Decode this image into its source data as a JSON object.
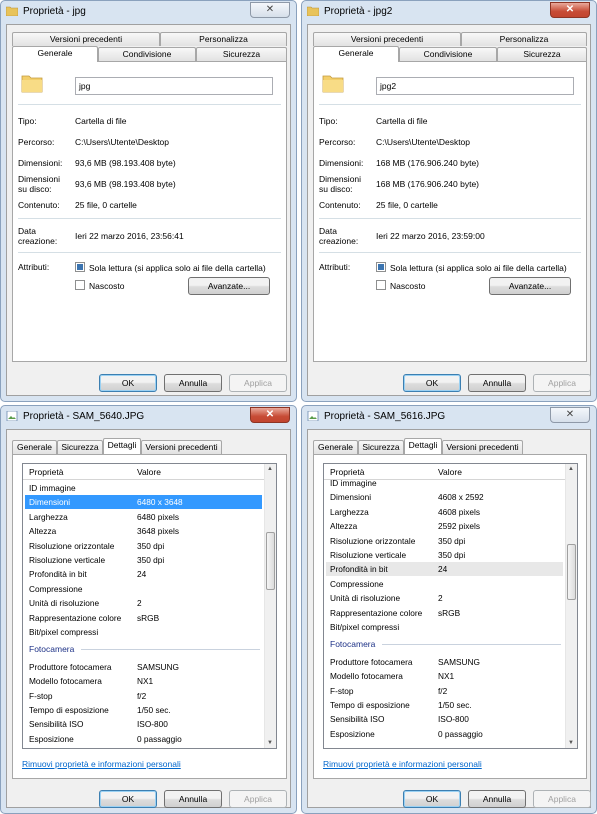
{
  "w1": {
    "title": "Proprietà - jpg",
    "tabs_top": [
      "Versioni precedenti",
      "Personalizza"
    ],
    "tabs_bottom": [
      "Generale",
      "Condivisione",
      "Sicurezza"
    ],
    "name_value": "jpg",
    "rows": [
      {
        "label": "Tipo:",
        "value": "Cartella di file"
      },
      {
        "label": "Percorso:",
        "value": "C:\\Users\\Utente\\Desktop"
      },
      {
        "label": "Dimensioni:",
        "value": "93,6 MB (98.193.408 byte)"
      },
      {
        "label": "Dimensioni su disco:",
        "value": "93,6 MB (98.193.408 byte)"
      },
      {
        "label": "Contenuto:",
        "value": "25 file, 0 cartelle"
      },
      {
        "label": "Data creazione:",
        "value": "Ieri 22 marzo 2016, 23:56:41"
      }
    ],
    "attr_label": "Attributi:",
    "readonly_label": "Sola lettura (si applica solo ai file della cartella)",
    "hidden_label": "Nascosto",
    "advanced_label": "Avanzate...",
    "ok": "OK",
    "cancel": "Annulla",
    "apply": "Applica"
  },
  "w2": {
    "title": "Proprietà - jpg2",
    "tabs_top": [
      "Versioni precedenti",
      "Personalizza"
    ],
    "tabs_bottom": [
      "Generale",
      "Condivisione",
      "Sicurezza"
    ],
    "name_value": "jpg2",
    "rows": [
      {
        "label": "Tipo:",
        "value": "Cartella di file"
      },
      {
        "label": "Percorso:",
        "value": "C:\\Users\\Utente\\Desktop"
      },
      {
        "label": "Dimensioni:",
        "value": "168 MB (176.906.240 byte)"
      },
      {
        "label": "Dimensioni su disco:",
        "value": "168 MB (176.906.240 byte)"
      },
      {
        "label": "Contenuto:",
        "value": "25 file, 0 cartelle"
      },
      {
        "label": "Data creazione:",
        "value": "Ieri 22 marzo 2016, 23:59:00"
      }
    ],
    "attr_label": "Attributi:",
    "readonly_label": "Sola lettura (si applica solo ai file della cartella)",
    "hidden_label": "Nascosto",
    "advanced_label": "Avanzate...",
    "ok": "OK",
    "cancel": "Annulla",
    "apply": "Applica"
  },
  "w3": {
    "title": "Proprietà - SAM_5640.JPG",
    "tabs": [
      "Generale",
      "Sicurezza",
      "Dettagli",
      "Versioni precedenti"
    ],
    "col_prop": "Proprietà",
    "col_val": "Valore",
    "rows": [
      {
        "k": "ID immagine",
        "v": ""
      },
      {
        "k": "Dimensioni",
        "v": "6480 x 3648"
      },
      {
        "k": "Larghezza",
        "v": "6480 pixels"
      },
      {
        "k": "Altezza",
        "v": "3648 pixels"
      },
      {
        "k": "Risoluzione orizzontale",
        "v": "350 dpi"
      },
      {
        "k": "Risoluzione verticale",
        "v": "350 dpi"
      },
      {
        "k": "Profondità in bit",
        "v": "24"
      },
      {
        "k": "Compressione",
        "v": ""
      },
      {
        "k": "Unità di risoluzione",
        "v": "2"
      },
      {
        "k": "Rappresentazione colore",
        "v": "sRGB"
      },
      {
        "k": "Bit/pixel compressi",
        "v": ""
      }
    ],
    "group": "Fotocamera",
    "rows2": [
      {
        "k": "Produttore fotocamera",
        "v": "SAMSUNG"
      },
      {
        "k": "Modello fotocamera",
        "v": "NX1"
      },
      {
        "k": "F-stop",
        "v": "f/2"
      },
      {
        "k": "Tempo di esposizione",
        "v": "1/50 sec."
      },
      {
        "k": "Sensibilità ISO",
        "v": "ISO-800"
      },
      {
        "k": "Esposizione",
        "v": "0 passaggio"
      }
    ],
    "link": "Rimuovi proprietà e informazioni personali",
    "ok": "OK",
    "cancel": "Annulla",
    "apply": "Applica"
  },
  "w4": {
    "title": "Proprietà - SAM_5616.JPG",
    "tabs": [
      "Generale",
      "Sicurezza",
      "Dettagli",
      "Versioni precedenti"
    ],
    "col_prop": "Proprietà",
    "col_val": "Valore",
    "rows": [
      {
        "k": "ID immagine",
        "v": ""
      },
      {
        "k": "Dimensioni",
        "v": "4608 x 2592"
      },
      {
        "k": "Larghezza",
        "v": "4608 pixels"
      },
      {
        "k": "Altezza",
        "v": "2592 pixels"
      },
      {
        "k": "Risoluzione orizzontale",
        "v": "350 dpi"
      },
      {
        "k": "Risoluzione verticale",
        "v": "350 dpi"
      },
      {
        "k": "Profondità in bit",
        "v": "24"
      },
      {
        "k": "Compressione",
        "v": ""
      },
      {
        "k": "Unità di risoluzione",
        "v": "2"
      },
      {
        "k": "Rappresentazione colore",
        "v": "sRGB"
      },
      {
        "k": "Bit/pixel compressi",
        "v": ""
      }
    ],
    "group": "Fotocamera",
    "rows2": [
      {
        "k": "Produttore fotocamera",
        "v": "SAMSUNG"
      },
      {
        "k": "Modello fotocamera",
        "v": "NX1"
      },
      {
        "k": "F-stop",
        "v": "f/2"
      },
      {
        "k": "Tempo di esposizione",
        "v": "1/50 sec."
      },
      {
        "k": "Sensibilità ISO",
        "v": "ISO-800"
      },
      {
        "k": "Esposizione",
        "v": "0 passaggio"
      }
    ],
    "link": "Rimuovi proprietà e informazioni personali",
    "ok": "OK",
    "cancel": "Annulla",
    "apply": "Applica"
  }
}
